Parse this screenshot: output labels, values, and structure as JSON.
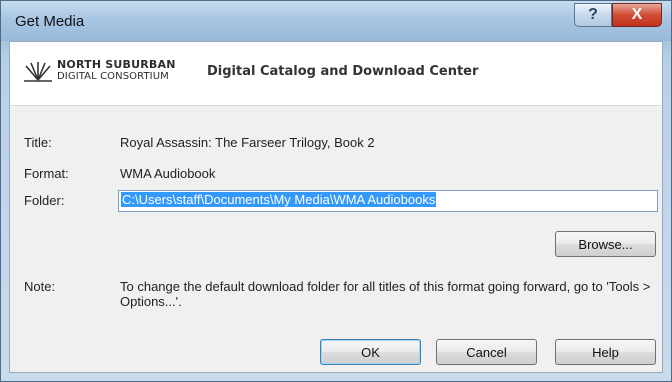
{
  "window": {
    "title": "Get Media",
    "help_glyph": "?",
    "close_glyph": "X"
  },
  "banner": {
    "logo_line1": "NORTH SUBURBAN",
    "logo_line2": "DIGITAL CONSORTIUM",
    "caption": "Digital Catalog and Download Center"
  },
  "fields": {
    "title_label": "Title:",
    "title_value": "Royal Assassin: The Farseer Trilogy, Book 2",
    "format_label": "Format:",
    "format_value": "WMA Audiobook",
    "folder_label": "Folder:",
    "folder_value": "C:\\Users\\staff\\Documents\\My Media\\WMA Audiobooks"
  },
  "buttons": {
    "browse": "Browse...",
    "ok": "OK",
    "cancel": "Cancel",
    "help": "Help"
  },
  "note": {
    "label": "Note:",
    "text": "To change the default download folder for all titles of this format going forward, go to 'Tools > Options...'."
  },
  "colors": {
    "selection": "#3399ff",
    "close_button": "#c2331c"
  }
}
